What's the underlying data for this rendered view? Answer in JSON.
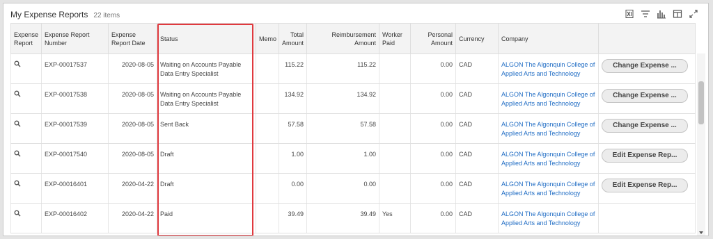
{
  "header": {
    "title": "My Expense Reports",
    "count": "22 items"
  },
  "toolbar_icons": [
    "excel-export-icon",
    "filter-icon",
    "chart-icon",
    "columns-icon",
    "fullscreen-icon"
  ],
  "columns": {
    "report": "Expense Report",
    "number": "Expense Report Number",
    "date": "Expense Report Date",
    "status": "Status",
    "memo": "Memo",
    "total": "Total Amount",
    "reimbursement": "Reimbursement Amount",
    "worker_paid": "Worker Paid",
    "personal": "Personal Amount",
    "currency": "Currency",
    "company": "Company"
  },
  "rows": [
    {
      "number": "EXP-00017537",
      "date": "2020-08-05",
      "status": "Waiting on Accounts Payable Data Entry Specialist",
      "memo": "",
      "total": "115.22",
      "reimbursement": "115.22",
      "worker_paid": "",
      "personal": "0.00",
      "currency": "CAD",
      "company": "ALGON The Algonquin College of Applied Arts and Technology",
      "action": "Change Expense ..."
    },
    {
      "number": "EXP-00017538",
      "date": "2020-08-05",
      "status": "Waiting on Accounts Payable Data Entry Specialist",
      "memo": "",
      "total": "134.92",
      "reimbursement": "134.92",
      "worker_paid": "",
      "personal": "0.00",
      "currency": "CAD",
      "company": "ALGON The Algonquin College of Applied Arts and Technology",
      "action": "Change Expense ..."
    },
    {
      "number": "EXP-00017539",
      "date": "2020-08-05",
      "status": "Sent Back",
      "memo": "",
      "total": "57.58",
      "reimbursement": "57.58",
      "worker_paid": "",
      "personal": "0.00",
      "currency": "CAD",
      "company": "ALGON The Algonquin College of Applied Arts and Technology",
      "action": "Change Expense ..."
    },
    {
      "number": "EXP-00017540",
      "date": "2020-08-05",
      "status": "Draft",
      "memo": "",
      "total": "1.00",
      "reimbursement": "1.00",
      "worker_paid": "",
      "personal": "0.00",
      "currency": "CAD",
      "company": "ALGON The Algonquin College of Applied Arts and Technology",
      "action": "Edit Expense Rep..."
    },
    {
      "number": "EXP-00016401",
      "date": "2020-04-22",
      "status": "Draft",
      "memo": "",
      "total": "0.00",
      "reimbursement": "0.00",
      "worker_paid": "",
      "personal": "0.00",
      "currency": "CAD",
      "company": "ALGON The Algonquin College of Applied Arts and Technology",
      "action": "Edit Expense Rep..."
    },
    {
      "number": "EXP-00016402",
      "date": "2020-04-22",
      "status": "Paid",
      "memo": "",
      "total": "39.49",
      "reimbursement": "39.49",
      "worker_paid": "Yes",
      "personal": "0.00",
      "currency": "CAD",
      "company": "ALGON The Algonquin College of Applied Arts and Technology",
      "action": ""
    }
  ],
  "highlight_color": "#e0393e",
  "link_color": "#1f6cc4"
}
